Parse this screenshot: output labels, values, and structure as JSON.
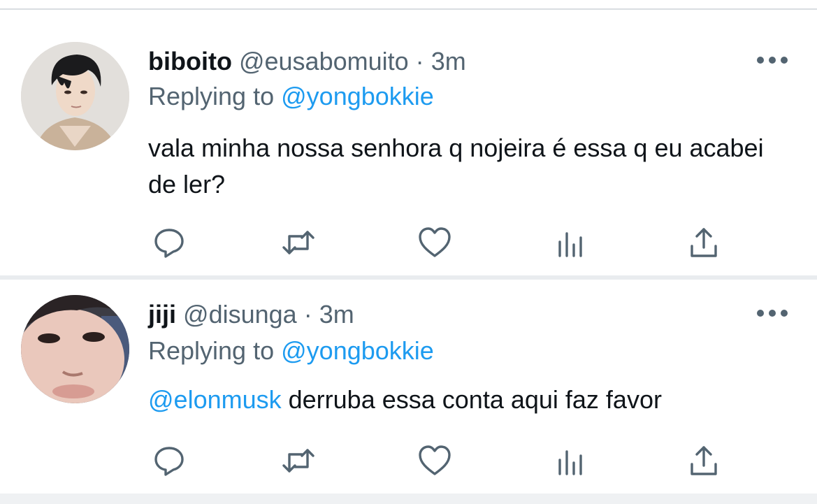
{
  "tweets": [
    {
      "name": "biboito",
      "handle": "@eusabomuito",
      "separator": "·",
      "time": "3m",
      "replying_prefix": "Replying to",
      "replying_to": "@yongbokkie",
      "text_mention": "",
      "text": "vala minha nossa senhora q nojeira é essa q eu acabei de ler?",
      "avatar_icon": "profile-photo-dark-hair"
    },
    {
      "name": "jiji",
      "handle": "@disunga",
      "separator": "·",
      "time": "3m",
      "replying_prefix": "Replying to",
      "replying_to": "@yongbokkie",
      "text_mention": "@elonmusk",
      "text": "derruba essa conta aqui faz favor",
      "avatar_icon": "profile-photo-face-closeup"
    }
  ],
  "action_icons": [
    "reply-icon",
    "retweet-icon",
    "like-icon",
    "analytics-icon",
    "share-icon"
  ],
  "colors": {
    "link": "#1d9bf0",
    "secondary_text": "#536471",
    "primary_text": "#0f1419",
    "divider": "#e9ecef"
  }
}
